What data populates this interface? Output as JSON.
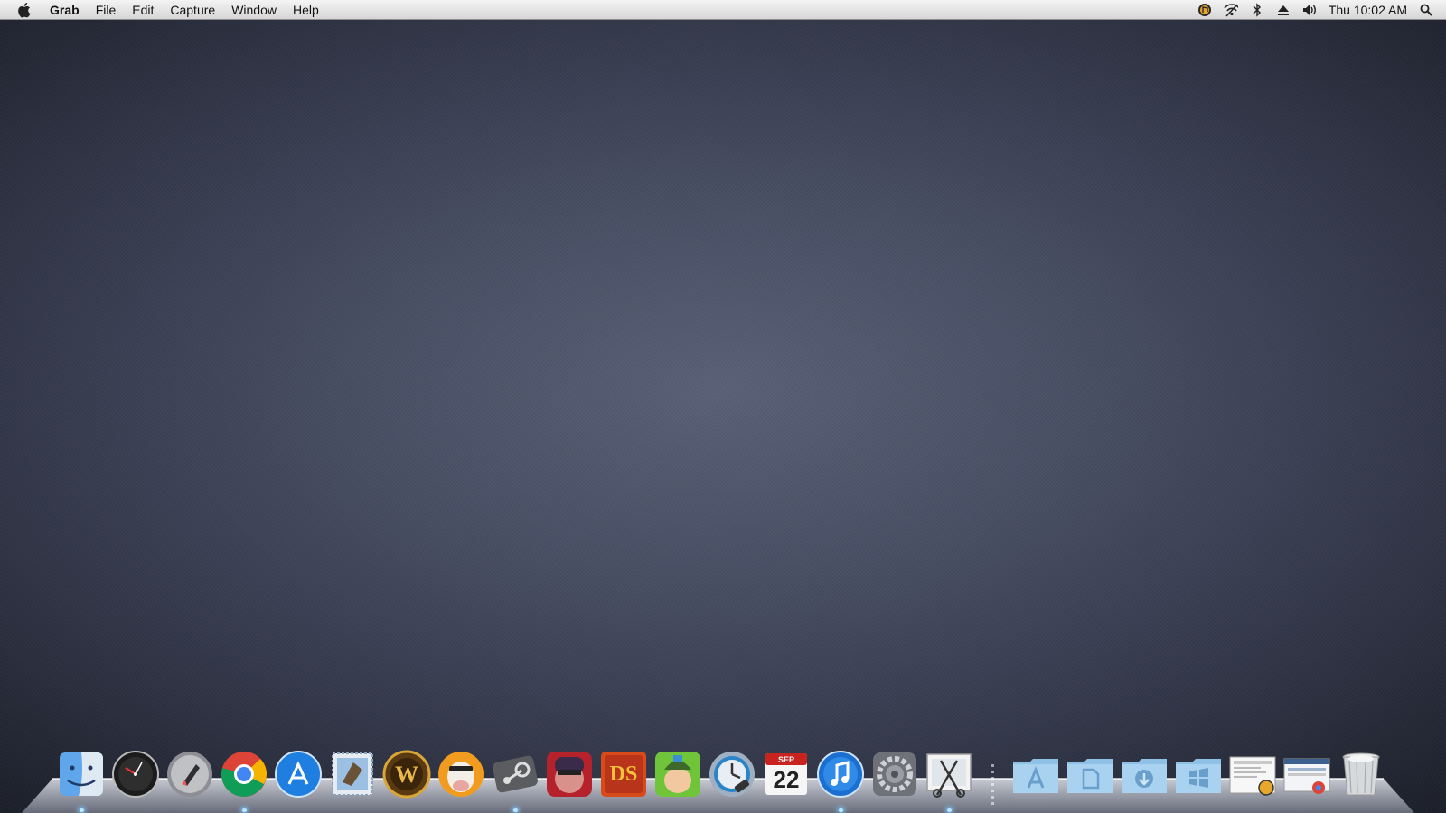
{
  "menubar": {
    "app_name": "Grab",
    "menus": [
      "File",
      "Edit",
      "Capture",
      "Window",
      "Help"
    ],
    "status_icons": [
      "audio-app-icon",
      "wifi-icon",
      "bluetooth-icon",
      "eject-icon",
      "volume-icon"
    ],
    "clock": "Thu 10:02 AM"
  },
  "dock": {
    "apps": [
      {
        "name": "finder",
        "running": true
      },
      {
        "name": "dashboard",
        "running": false
      },
      {
        "name": "launchpad",
        "running": false
      },
      {
        "name": "chrome",
        "running": true
      },
      {
        "name": "app-store",
        "running": false
      },
      {
        "name": "mail",
        "running": false
      },
      {
        "name": "world-of-warcraft",
        "running": false
      },
      {
        "name": "cow-game",
        "running": false
      },
      {
        "name": "steam",
        "running": true
      },
      {
        "name": "hacker-game",
        "running": false
      },
      {
        "name": "ds-game",
        "running": false
      },
      {
        "name": "soldier-game",
        "running": false
      },
      {
        "name": "time-machine",
        "running": false
      },
      {
        "name": "calendar",
        "running": false
      },
      {
        "name": "itunes",
        "running": true
      },
      {
        "name": "system-preferences",
        "running": false
      },
      {
        "name": "grab",
        "running": true
      }
    ],
    "calendar": {
      "month": "SEP",
      "day": "22"
    },
    "stacks": [
      "applications-folder",
      "documents-folder",
      "downloads-folder",
      "windows-folder",
      "stack-file-1",
      "stack-file-2",
      "trash"
    ]
  },
  "colors": {
    "wallpaper_center": "#5a6178",
    "wallpaper_edge": "#1c1f29",
    "menubar": "#e6e6e6"
  }
}
